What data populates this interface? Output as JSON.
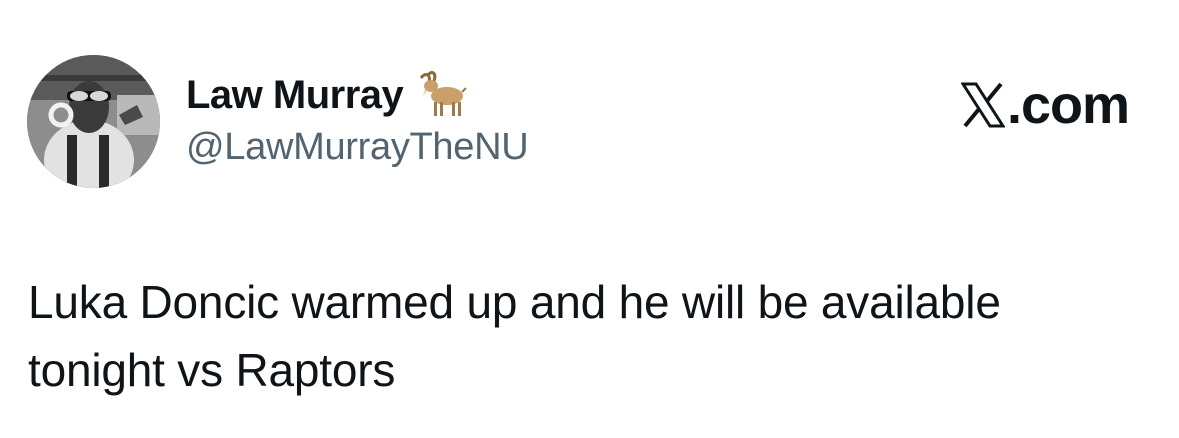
{
  "author": {
    "display_name": "Law Murray",
    "badge_emoji": "goat-icon",
    "handle": "@LawMurrayTheNU",
    "avatar": "profile-photo"
  },
  "brand": {
    "label": ".com",
    "mark": "x-logo-icon"
  },
  "tweet": {
    "lines": [
      "Luka Doncic warmed up and he will be available",
      "tonight vs Raptors"
    ]
  },
  "colors": {
    "text_primary": "#0f1419",
    "text_secondary": "#536471",
    "background": "#ffffff"
  }
}
